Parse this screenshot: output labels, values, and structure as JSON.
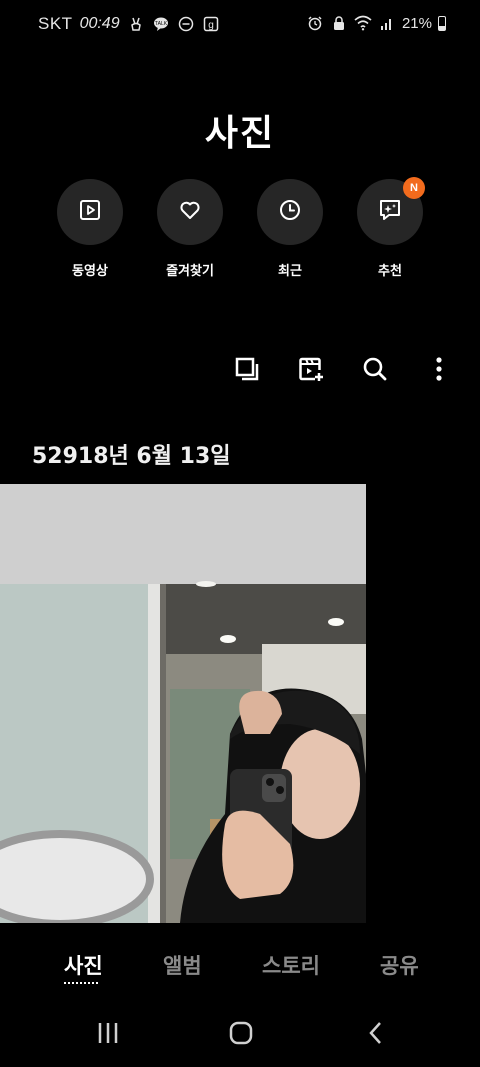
{
  "status_bar": {
    "carrier": "SKT",
    "time": "00:49",
    "left_icons": [
      "peace-hand-icon",
      "kakaotalk-icon",
      "do-not-disturb-icon",
      "app-g-icon"
    ],
    "right_icons": [
      "alarm-icon",
      "lock-icon",
      "wifi-icon",
      "signal-icon"
    ],
    "battery": "21%"
  },
  "title": "사진",
  "quick": [
    {
      "label": "동영상",
      "icon": "play-square-icon"
    },
    {
      "label": "즐겨찾기",
      "icon": "heart-icon"
    },
    {
      "label": "최근",
      "icon": "clock-icon"
    },
    {
      "label": "추천",
      "icon": "sparkle-chat-icon",
      "badge": "N"
    }
  ],
  "toolbar": [
    "select-icon",
    "create-video-icon",
    "search-icon",
    "more-options-icon"
  ],
  "date_header": "52918년 6월 13일",
  "tabs": [
    {
      "label": "사진",
      "active": true
    },
    {
      "label": "앨범",
      "active": false
    },
    {
      "label": "스토리",
      "active": false
    },
    {
      "label": "공유",
      "active": false
    }
  ],
  "nav": [
    "recent-apps-icon",
    "home-icon",
    "back-icon"
  ],
  "colors": {
    "background": "#000000",
    "circle": "#262626",
    "badge": "#f26b1d",
    "inactive_tab": "#8a8a8a"
  }
}
